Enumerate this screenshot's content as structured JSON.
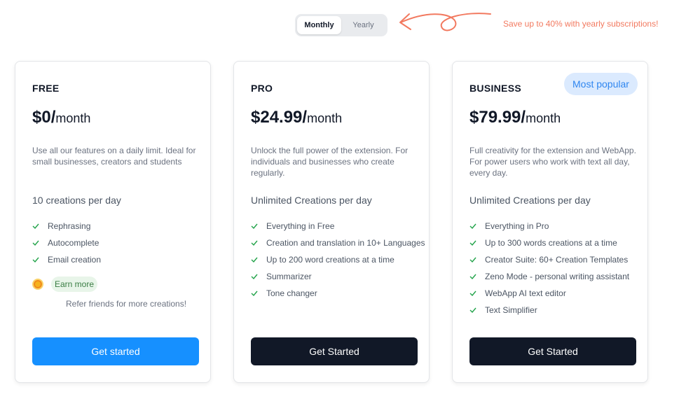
{
  "toggle": {
    "monthly": "Monthly",
    "yearly": "Yearly",
    "selected": "Monthly"
  },
  "promo": "Save up to 40% with yearly subscriptions!",
  "colors": {
    "accent_blue": "#1690ff",
    "dark_button": "#111827",
    "promo": "#f2795f",
    "check": "#22a34a",
    "badge_bg": "#dbeafe"
  },
  "plans": [
    {
      "name": "FREE",
      "price": "$0/",
      "period": "month",
      "description": "Use all our features on a daily limit. Ideal for small businesses, creators and students",
      "quota": "10 creations per day",
      "features": [
        "Rephrasing",
        "Autocomplete",
        "Email creation"
      ],
      "earn_more": "Earn more",
      "refer": "Refer friends for more creations!",
      "cta": "Get started"
    },
    {
      "name": "PRO",
      "price": "$24.99/",
      "period": "month",
      "description": "Unlock the full power of the extension. For individuals and businesses who create regularly.",
      "quota": "Unlimited Creations per day",
      "features": [
        "Everything in Free",
        "Creation and translation in 10+ Languages",
        "Up to 200 word creations at a time",
        "Summarizer",
        "Tone changer"
      ],
      "cta": "Get Started"
    },
    {
      "name": "BUSINESS",
      "badge": "Most popular",
      "price": "$79.99/",
      "period": "month",
      "description": "Full creativity for the extension and WebApp. For power users who work with text all day, every day.",
      "quota": "Unlimited Creations per day",
      "features": [
        "Everything in Pro",
        "Up to 300 words creations at a time",
        "Creator Suite: 60+ Creation Templates",
        "Zeno Mode - personal writing assistant",
        "WebApp AI text editor",
        "Text Simplifier"
      ],
      "cta": "Get Started"
    }
  ]
}
